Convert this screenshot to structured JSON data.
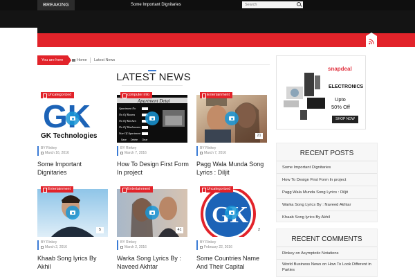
{
  "topbar": {
    "breaking_label": "BREAKING",
    "ticker_text": "Some Important Dignitaries",
    "search_placeholder": "Search"
  },
  "breadcrumb": {
    "here_label": "You are here",
    "home_label": "Home",
    "current_label": "Latest News"
  },
  "section_title": "LATEST NEWS",
  "posts": [
    {
      "category": "Uncategorized",
      "author": "BY Rinkey",
      "date": "March 16, 2016",
      "title": "Some Important Dignitaries",
      "count": ""
    },
    {
      "category": "computer info",
      "author": "BY Rinkey",
      "date": "March 7, 2016",
      "title": "How To Design First Form In project",
      "count": ""
    },
    {
      "category": "Entertainment",
      "author": "BY Rinkey",
      "date": "March 7, 2016",
      "title": "Pagg Wala Munda Song Lyrics : Diljit",
      "count": "21"
    },
    {
      "category": "Entertainment",
      "author": "BY Rinkey",
      "date": "March 2, 2016",
      "title": "Khaab Song lyrics By Akhil",
      "count": "5"
    },
    {
      "category": "Entertainment",
      "author": "BY Rinkey",
      "date": "March 2, 2016",
      "title": "Warka Song Lyrics By : Naveed Akhtar",
      "count": "41"
    },
    {
      "category": "Uncategorized",
      "author": "BY Rinkey",
      "date": "February 22, 2016",
      "title": "Some Countries Name And Their Capital",
      "count": "2"
    }
  ],
  "thumb_text": {
    "gk_logo": "GK",
    "gk_caption": "GK Technologies",
    "form_title": "Apartment Detai",
    "form_rows": [
      "Apartment No",
      "No Of Rooms",
      "No Of Kitchen",
      "No Of Washrooms",
      "Size Of Apartment"
    ],
    "form_buttons": [
      "Save",
      "Delete",
      "Clear"
    ]
  },
  "ad": {
    "brand": "snapdeal",
    "category": "ELECTRONICS",
    "upto": "Upto",
    "discount": "50% Off",
    "cta": "SHOP NOW"
  },
  "recent_posts": {
    "title": "RECENT POSTS",
    "items": [
      "Some Important Dignitaries",
      "How To Design First Form In project",
      "Pagg Wala Munda Song Lyrics : Diljit",
      "Warka Song Lyrics By : Naveed Akhtar",
      "Khaab Song lyrics By Akhil"
    ]
  },
  "recent_comments": {
    "title": "RECENT COMMENTS",
    "items": [
      "Rinkey on Asymptotic Notations",
      "World Business News on How To Look Different in Parties"
    ]
  },
  "colors": {
    "accent_red": "#e2232a",
    "accent_blue": "#3a7bd5",
    "dark": "#141414"
  }
}
